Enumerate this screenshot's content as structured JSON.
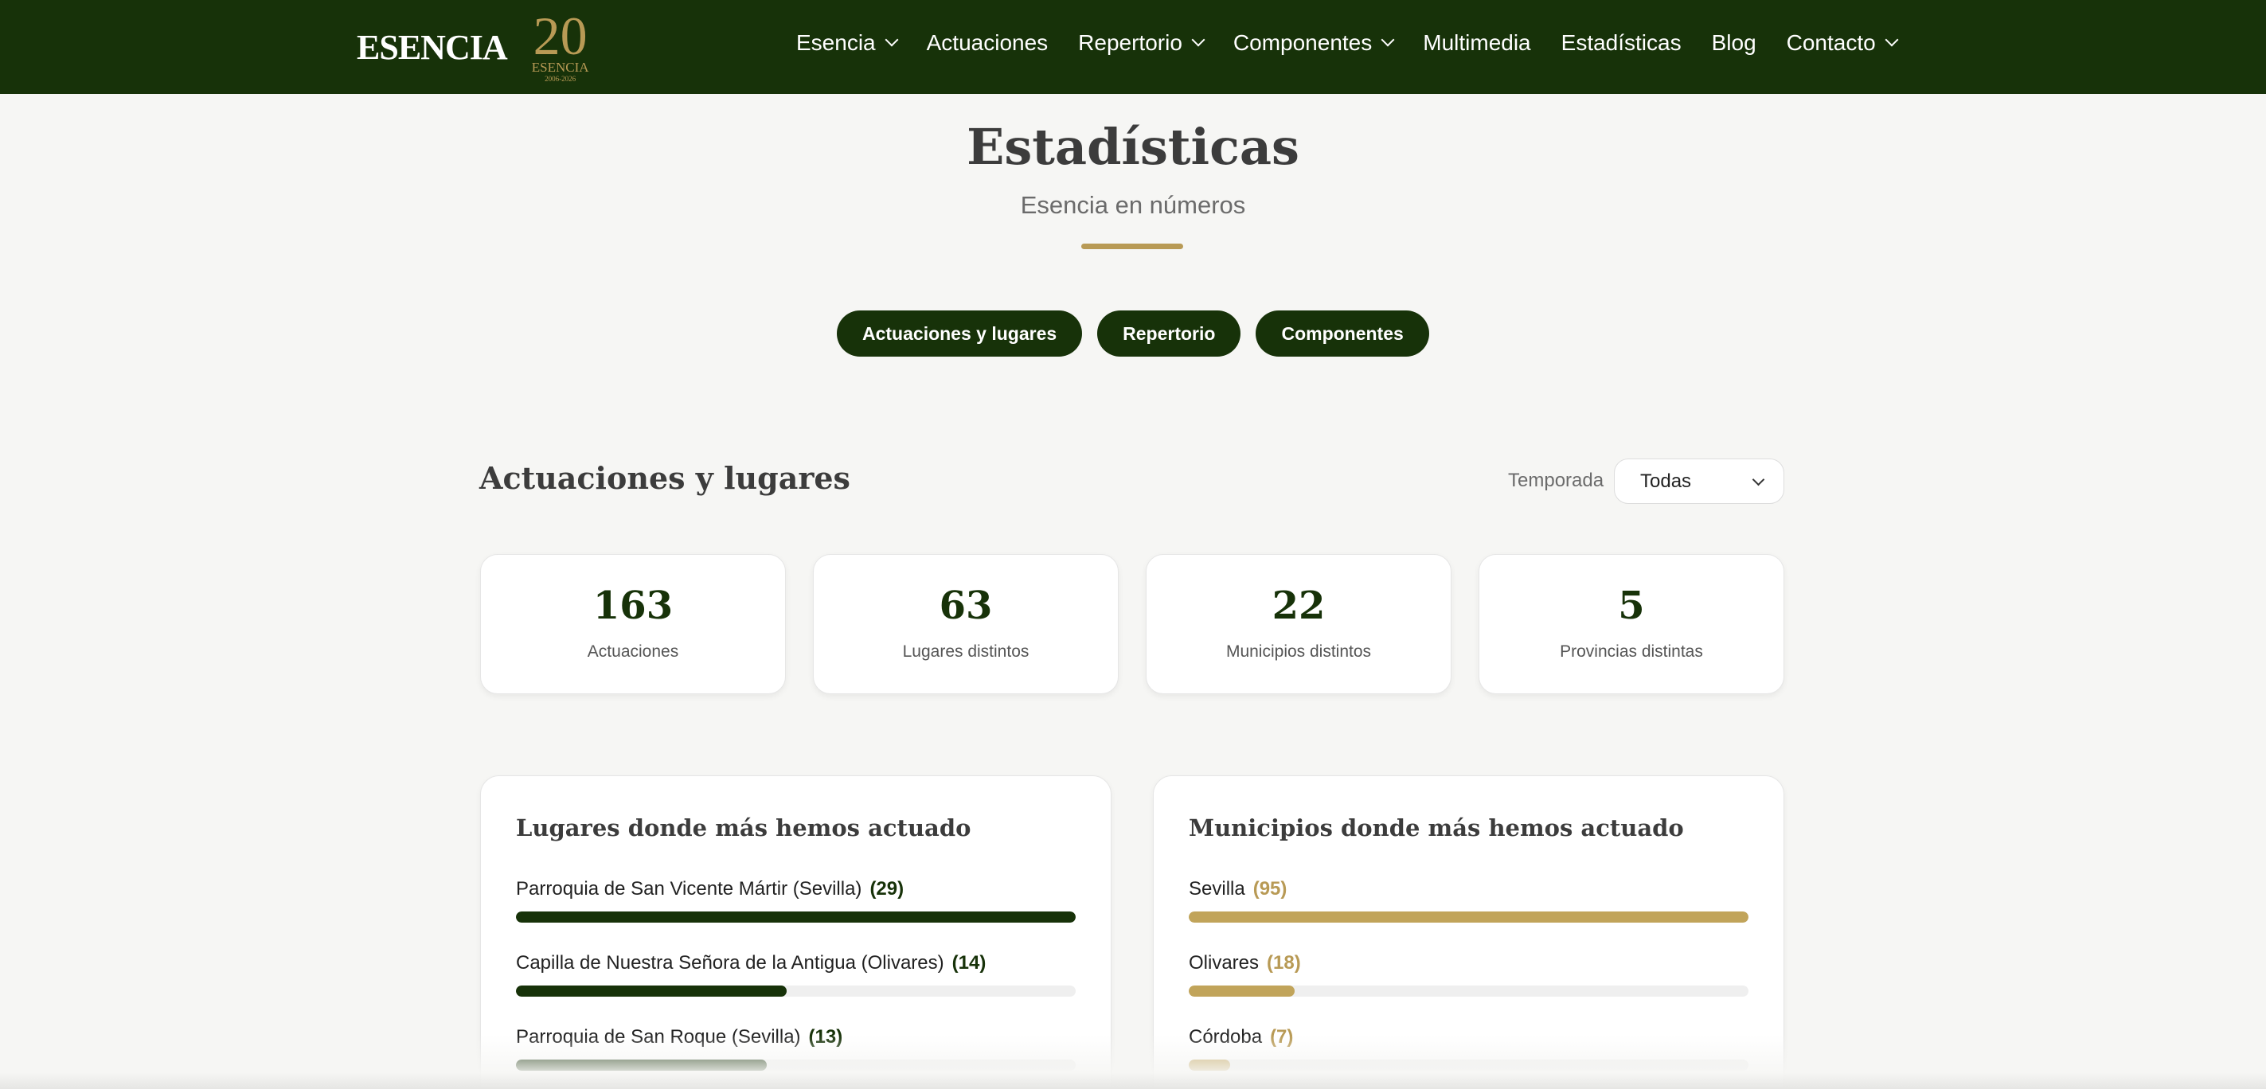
{
  "header": {
    "brand": "ESENCIA",
    "badge": {
      "number": "20",
      "name": "ESENCIA",
      "years": "2006-2026"
    },
    "nav": [
      {
        "label": "Esencia",
        "dropdown": true
      },
      {
        "label": "Actuaciones",
        "dropdown": false
      },
      {
        "label": "Repertorio",
        "dropdown": true
      },
      {
        "label": "Componentes",
        "dropdown": true
      },
      {
        "label": "Multimedia",
        "dropdown": false
      },
      {
        "label": "Estadísticas",
        "dropdown": false
      },
      {
        "label": "Blog",
        "dropdown": false
      },
      {
        "label": "Contacto",
        "dropdown": true
      }
    ]
  },
  "page": {
    "title": "Estadísticas",
    "subtitle": "Esencia en números"
  },
  "tabs": [
    {
      "label": "Actuaciones y lugares"
    },
    {
      "label": "Repertorio"
    },
    {
      "label": "Componentes"
    }
  ],
  "section": {
    "title": "Actuaciones y lugares",
    "season_label": "Temporada",
    "season_value": "Todas"
  },
  "stats": [
    {
      "value": "163",
      "label": "Actuaciones"
    },
    {
      "value": "63",
      "label": "Lugares distintos"
    },
    {
      "value": "22",
      "label": "Municipios distintos"
    },
    {
      "value": "5",
      "label": "Provincias distintas"
    }
  ],
  "places": {
    "title": "Lugares donde más hemos actuado",
    "items": [
      {
        "name": "Parroquia de San Vicente Mártir (Sevilla)",
        "count": "(29)",
        "fraction": 1.0
      },
      {
        "name": "Capilla de Nuestra Señora de la Antigua (Olivares)",
        "count": "(14)",
        "fraction": 0.483
      },
      {
        "name": "Parroquia de San Roque (Sevilla)",
        "count": "(13)",
        "fraction": 0.448
      }
    ]
  },
  "towns": {
    "title": "Municipios donde más hemos actuado",
    "items": [
      {
        "name": "Sevilla",
        "count": "(95)",
        "fraction": 1.0
      },
      {
        "name": "Olivares",
        "count": "(18)",
        "fraction": 0.189
      },
      {
        "name": "Córdoba",
        "count": "(7)",
        "fraction": 0.074
      }
    ]
  },
  "colors": {
    "primary": "#173209",
    "accent": "#b89a55",
    "background": "#f6f6f4"
  }
}
